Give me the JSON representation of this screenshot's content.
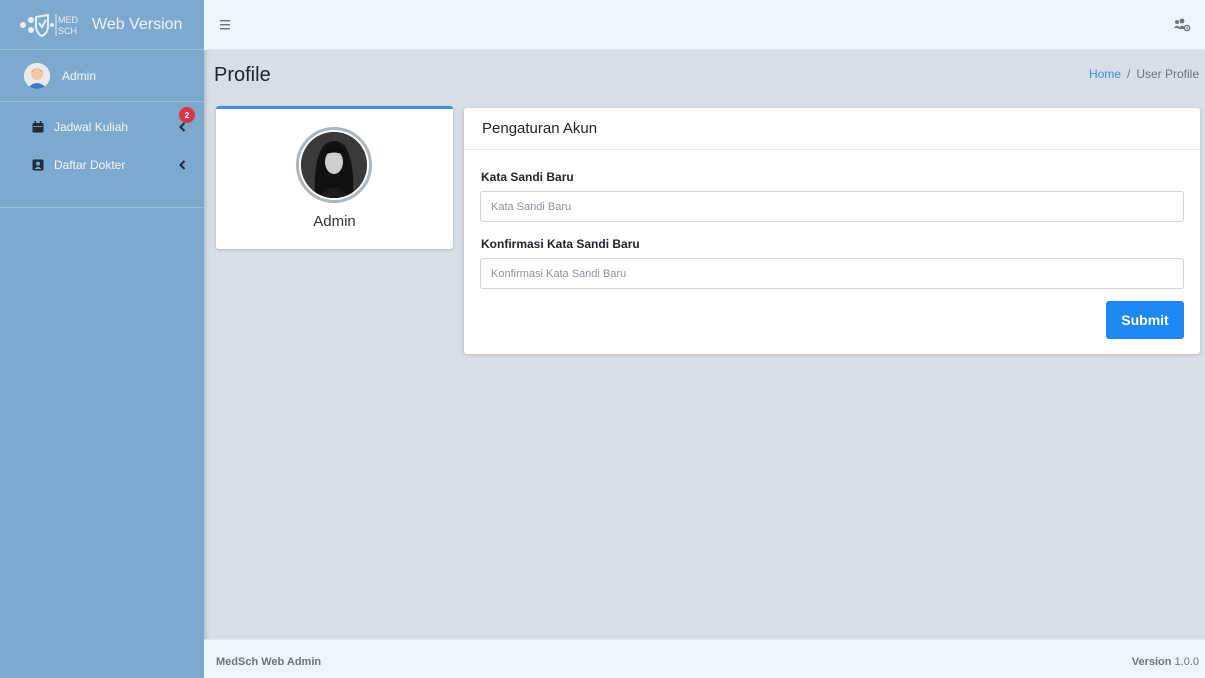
{
  "brand": {
    "logo_text": "MED SCH",
    "title": "Web Version"
  },
  "user_panel": {
    "name": "Admin"
  },
  "sidebar": {
    "items": [
      {
        "label": "Jadwal Kuliah",
        "icon": "calendar-icon",
        "badge": "2"
      },
      {
        "label": "Daftar Dokter",
        "icon": "id-card-icon"
      }
    ]
  },
  "header": {
    "page_title": "Profile"
  },
  "breadcrumb": {
    "home": "Home",
    "separator": "/",
    "current": "User Profile"
  },
  "profile": {
    "name": "Admin"
  },
  "account_settings": {
    "title": "Pengaturan Akun",
    "new_password_label": "Kata Sandi Baru",
    "new_password_placeholder": "Kata Sandi Baru",
    "confirm_password_label": "Konfirmasi Kata Sandi Baru",
    "confirm_password_placeholder": "Konfirmasi Kata Sandi Baru",
    "submit_label": "Submit"
  },
  "footer": {
    "left": "MedSch Web Admin",
    "version_label": "Version",
    "version_value": "1.0.0"
  },
  "colors": {
    "sidebar": "#7ea9cf",
    "primary": "#1e88f2",
    "badge": "#dc3545",
    "content_bg": "#d7dee6"
  }
}
